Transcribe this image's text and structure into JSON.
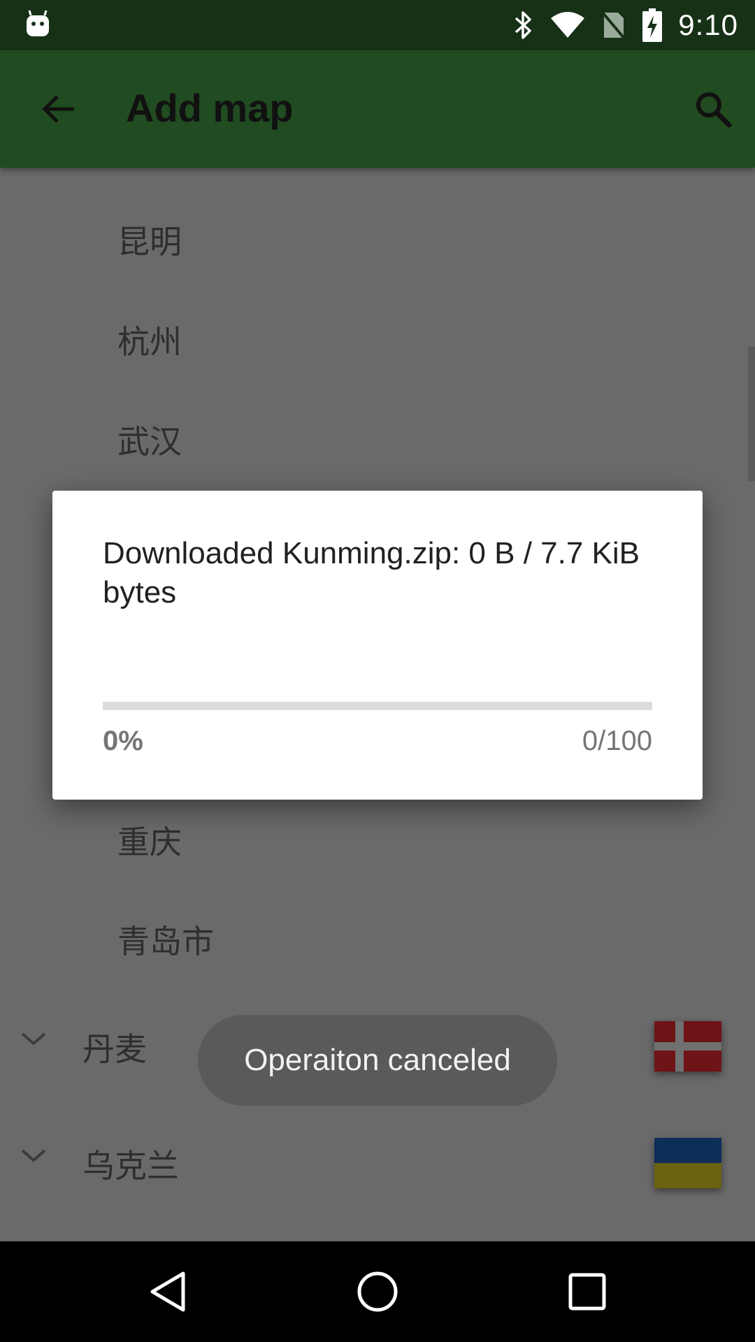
{
  "status_bar": {
    "time": "9:10",
    "icons": [
      "android-icon",
      "bluetooth-icon",
      "wifi-icon",
      "no-sim-icon",
      "battery-charging-icon"
    ]
  },
  "app_bar": {
    "title": "Add map",
    "back_icon": "arrow-back-icon",
    "search_icon": "search-icon"
  },
  "list": {
    "cities": [
      "昆明",
      "杭州",
      "武汉",
      "重庆",
      "青岛市"
    ],
    "countries": [
      {
        "name": "丹麦",
        "flag": "denmark-flag-icon"
      },
      {
        "name": "乌克兰",
        "flag": "ukraine-flag-icon"
      }
    ]
  },
  "dialog": {
    "message": "Downloaded Kunming.zip: 0 B / 7.7 KiB bytes",
    "progress": 0,
    "percent_label": "0%",
    "fraction_label": "0/100"
  },
  "toast": {
    "text": "Operaiton canceled"
  },
  "colors": {
    "status_bar": "#173117",
    "app_bar": "#214b21",
    "scrim_background": "#6a6a6a",
    "dialog": "#ffffff",
    "progress_track": "#dcdcdc",
    "toast": "#5a5a5a"
  },
  "nav_bar": {
    "icons": [
      "back-triangle-icon",
      "home-circle-icon",
      "recents-square-icon"
    ]
  }
}
